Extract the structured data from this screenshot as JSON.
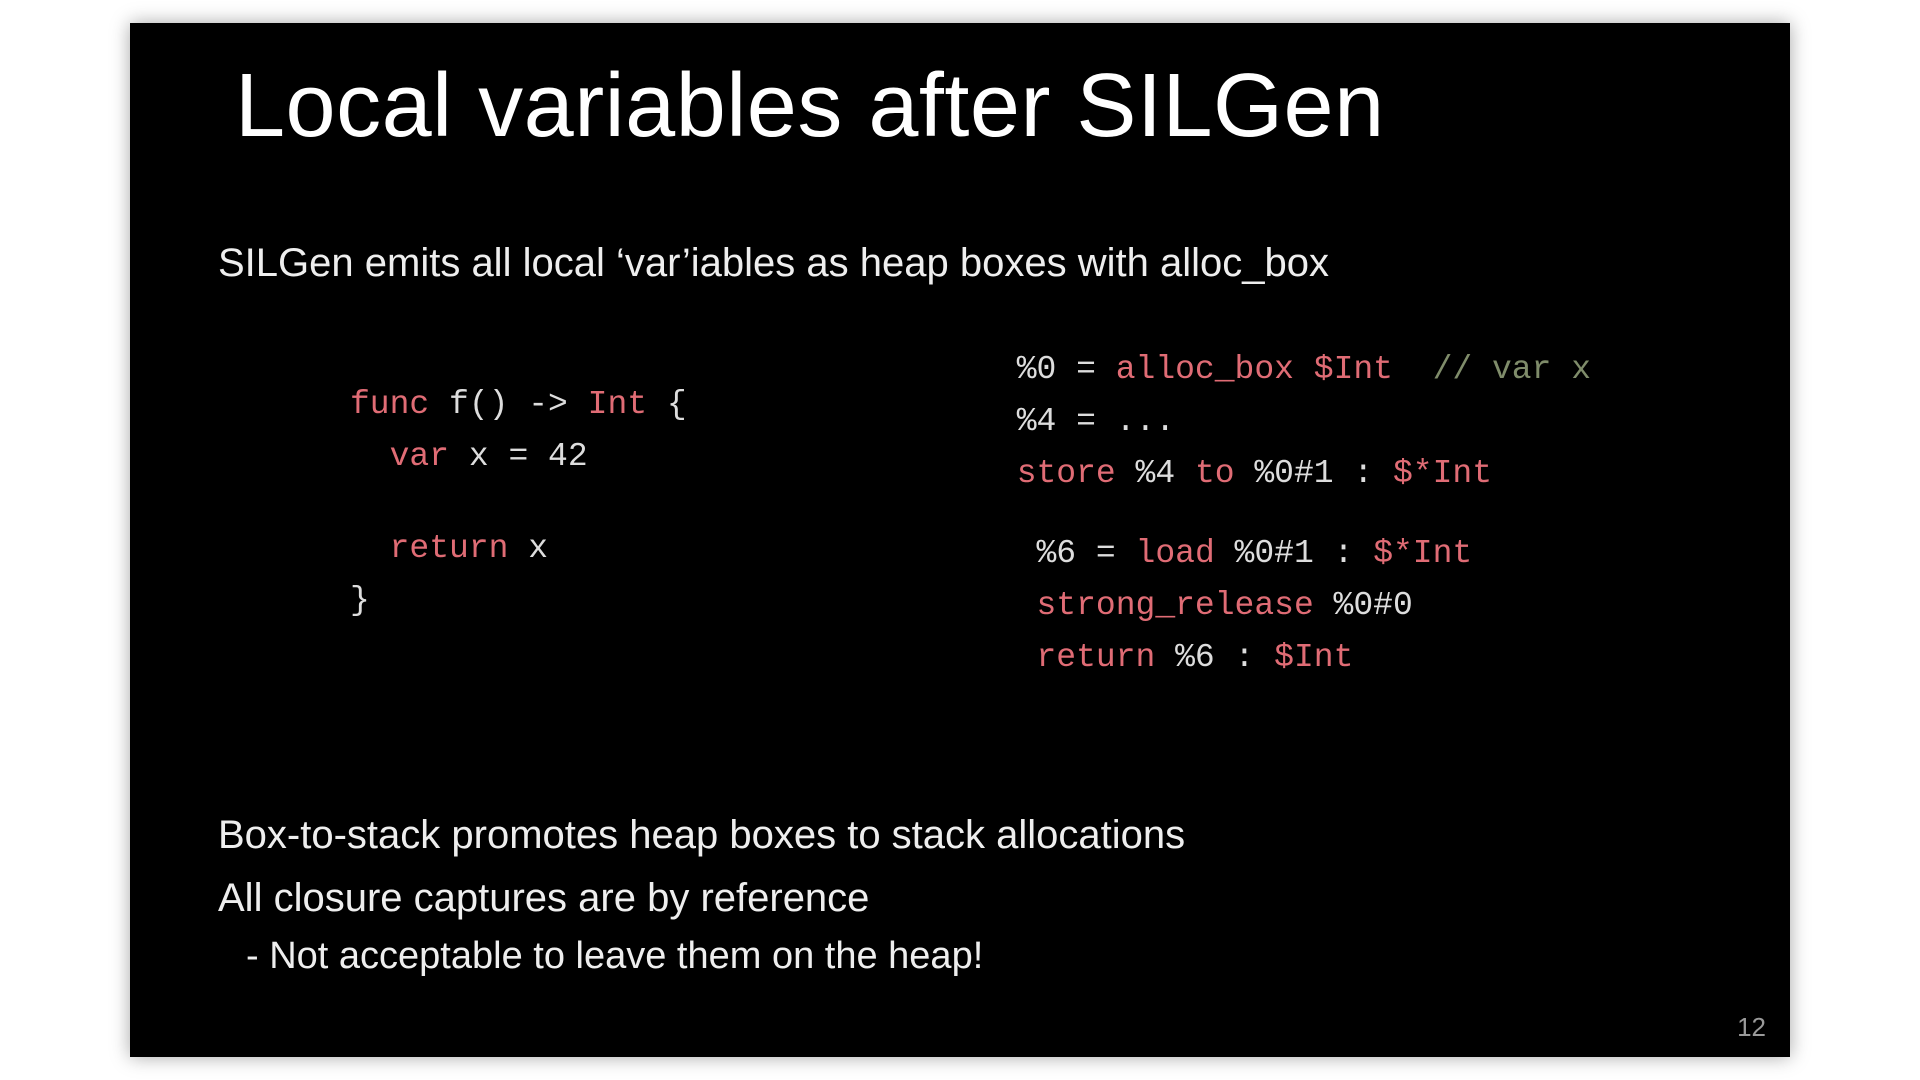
{
  "title": "Local variables after SILGen",
  "intro": "SILGen emits all local ‘var’iables as heap boxes with alloc_box",
  "swift": {
    "l1_kw": "func",
    "l1_rest_a": " f() -> ",
    "l1_ty": "Int",
    "l1_rest_b": " {",
    "l2_kw": "var",
    "l2_rest": " x = 42",
    "l3_kw": "return",
    "l3_rest": " x",
    "l4": "}"
  },
  "sil": {
    "a1_pre": "%0 = ",
    "a1_kw": "alloc_box",
    "a1_mid": " ",
    "a1_ty": "$Int",
    "a1_sp": "  ",
    "a1_cm": "// var x",
    "a2": "%4 = ...",
    "a3_kw": "store",
    "a3_mid": " %4 ",
    "a3_kw2": "to",
    "a3_mid2": " %0#1 : ",
    "a3_ty": "$*Int",
    "b1_pre": "%6 = ",
    "b1_kw": "load",
    "b1_mid": " %0#1 : ",
    "b1_ty": "$*Int",
    "b2_kw": "strong_release",
    "b2_rest": " %0#0",
    "b3_kw": "return",
    "b3_mid": " %6 : ",
    "b3_ty": "$Int"
  },
  "bottom": {
    "l1": "Box-to-stack promotes heap boxes to stack allocations",
    "l2": "All closure captures are by reference",
    "bullet": "Not acceptable to leave them on the heap!"
  },
  "pagenum": "12"
}
